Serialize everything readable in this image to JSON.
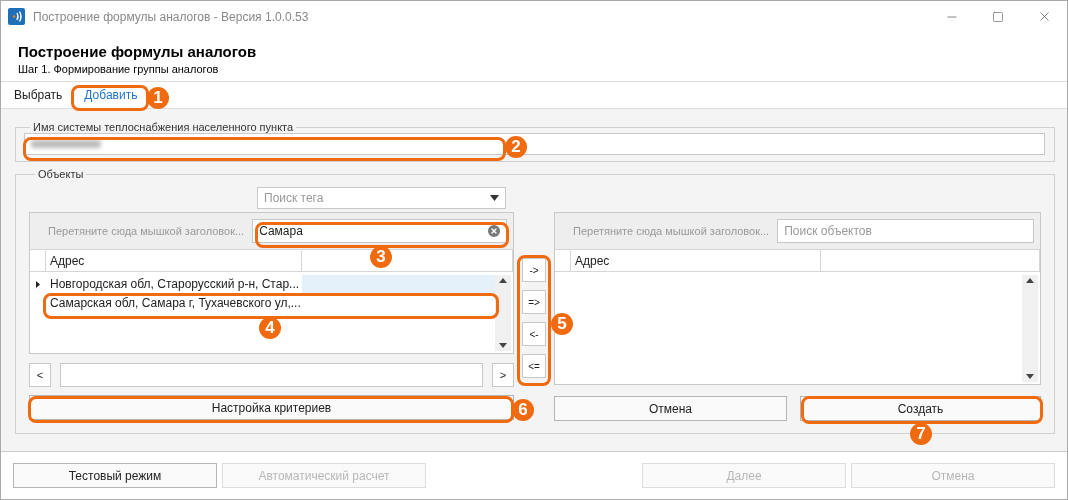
{
  "window": {
    "title": "Построение формулы аналогов - Версия 1.0.0.53"
  },
  "header": {
    "title": "Построение формулы аналогов",
    "subtitle": "Шаг 1. Формирование группы аналогов"
  },
  "tabs": [
    {
      "label": "Выбрать",
      "selected": false
    },
    {
      "label": "Добавить",
      "selected": true
    }
  ],
  "system_name": {
    "label": "Имя системы теплоснабжения населенного пункта"
  },
  "objects": {
    "label": "Объекты",
    "tag_search": {
      "placeholder": "Поиск тега"
    },
    "left_grid": {
      "group_hint": "Перетяните сюда мышкой заголовок...",
      "search_value": "Самара",
      "columns": [
        "Адрес"
      ],
      "rows": [
        {
          "address": "Новгородская обл, Старорусский р-н, Стар...",
          "selected": true
        },
        {
          "address": "Самарская обл, Самара г, Тухачевского ул,...",
          "selected": false
        }
      ],
      "prev": "<",
      "next": ">"
    },
    "move_buttons": [
      "->",
      "=>",
      "<-",
      "<="
    ],
    "right_grid": {
      "group_hint": "Перетяните сюда мышкой заголовок...",
      "search_placeholder": "Поиск объектов",
      "columns": [
        "Адрес"
      ]
    },
    "criteria_button": "Настройка критериев",
    "cancel_button": "Отмена",
    "create_button": "Создать"
  },
  "footer": [
    {
      "label": "Тестовый режим",
      "disabled": false
    },
    {
      "label": "Автоматический расчет",
      "disabled": true
    },
    {
      "label": "Далее",
      "disabled": true
    },
    {
      "label": "Отмена",
      "disabled": true
    }
  ],
  "callouts": [
    {
      "number": "1"
    },
    {
      "number": "2"
    },
    {
      "number": "3"
    },
    {
      "number": "4"
    },
    {
      "number": "5"
    },
    {
      "number": "6"
    },
    {
      "number": "7"
    }
  ]
}
